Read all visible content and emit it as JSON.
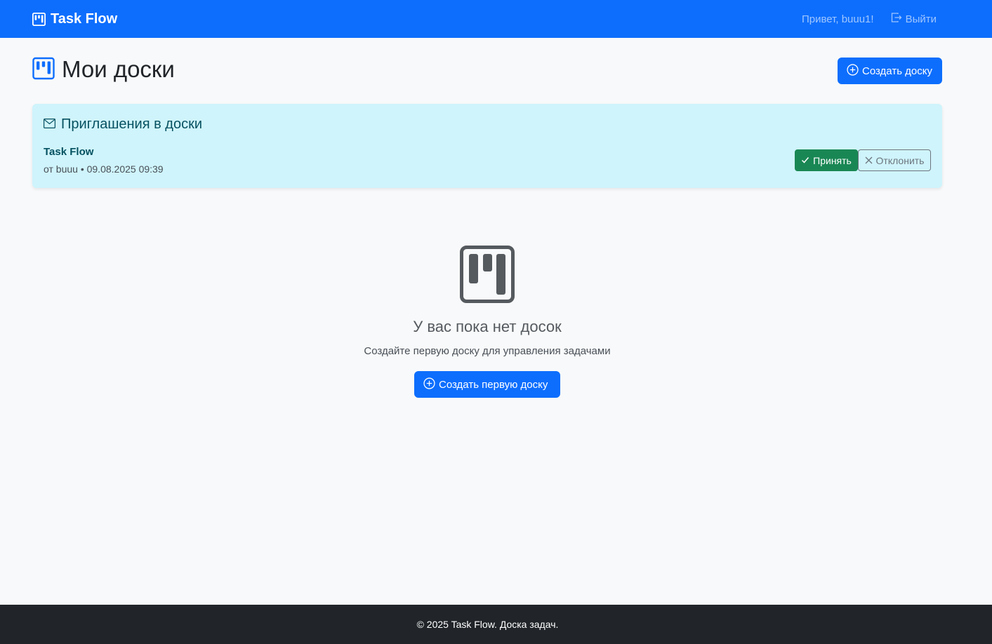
{
  "navbar": {
    "brand": "Task Flow",
    "greeting": "Привет, buuu1!",
    "logout_label": "Выйти"
  },
  "header": {
    "title": "Мои доски",
    "create_button": "Создать доску"
  },
  "invitations": {
    "title": "Приглашения в доски",
    "items": [
      {
        "board": "Task Flow",
        "meta": "от buuu • 09.08.2025 09:39",
        "accept_label": "Принять",
        "decline_label": "Отклонить"
      }
    ]
  },
  "empty_state": {
    "title": "У вас пока нет досок",
    "subtitle": "Создайте первую доску для управления задачами",
    "button": "Создать первую доску"
  },
  "footer": {
    "text": "© 2025 Task Flow. Доска задач."
  },
  "colors": {
    "primary": "#0d6efd",
    "success": "#198754",
    "info_bg": "#cff4fc",
    "footer_bg": "#212529"
  }
}
